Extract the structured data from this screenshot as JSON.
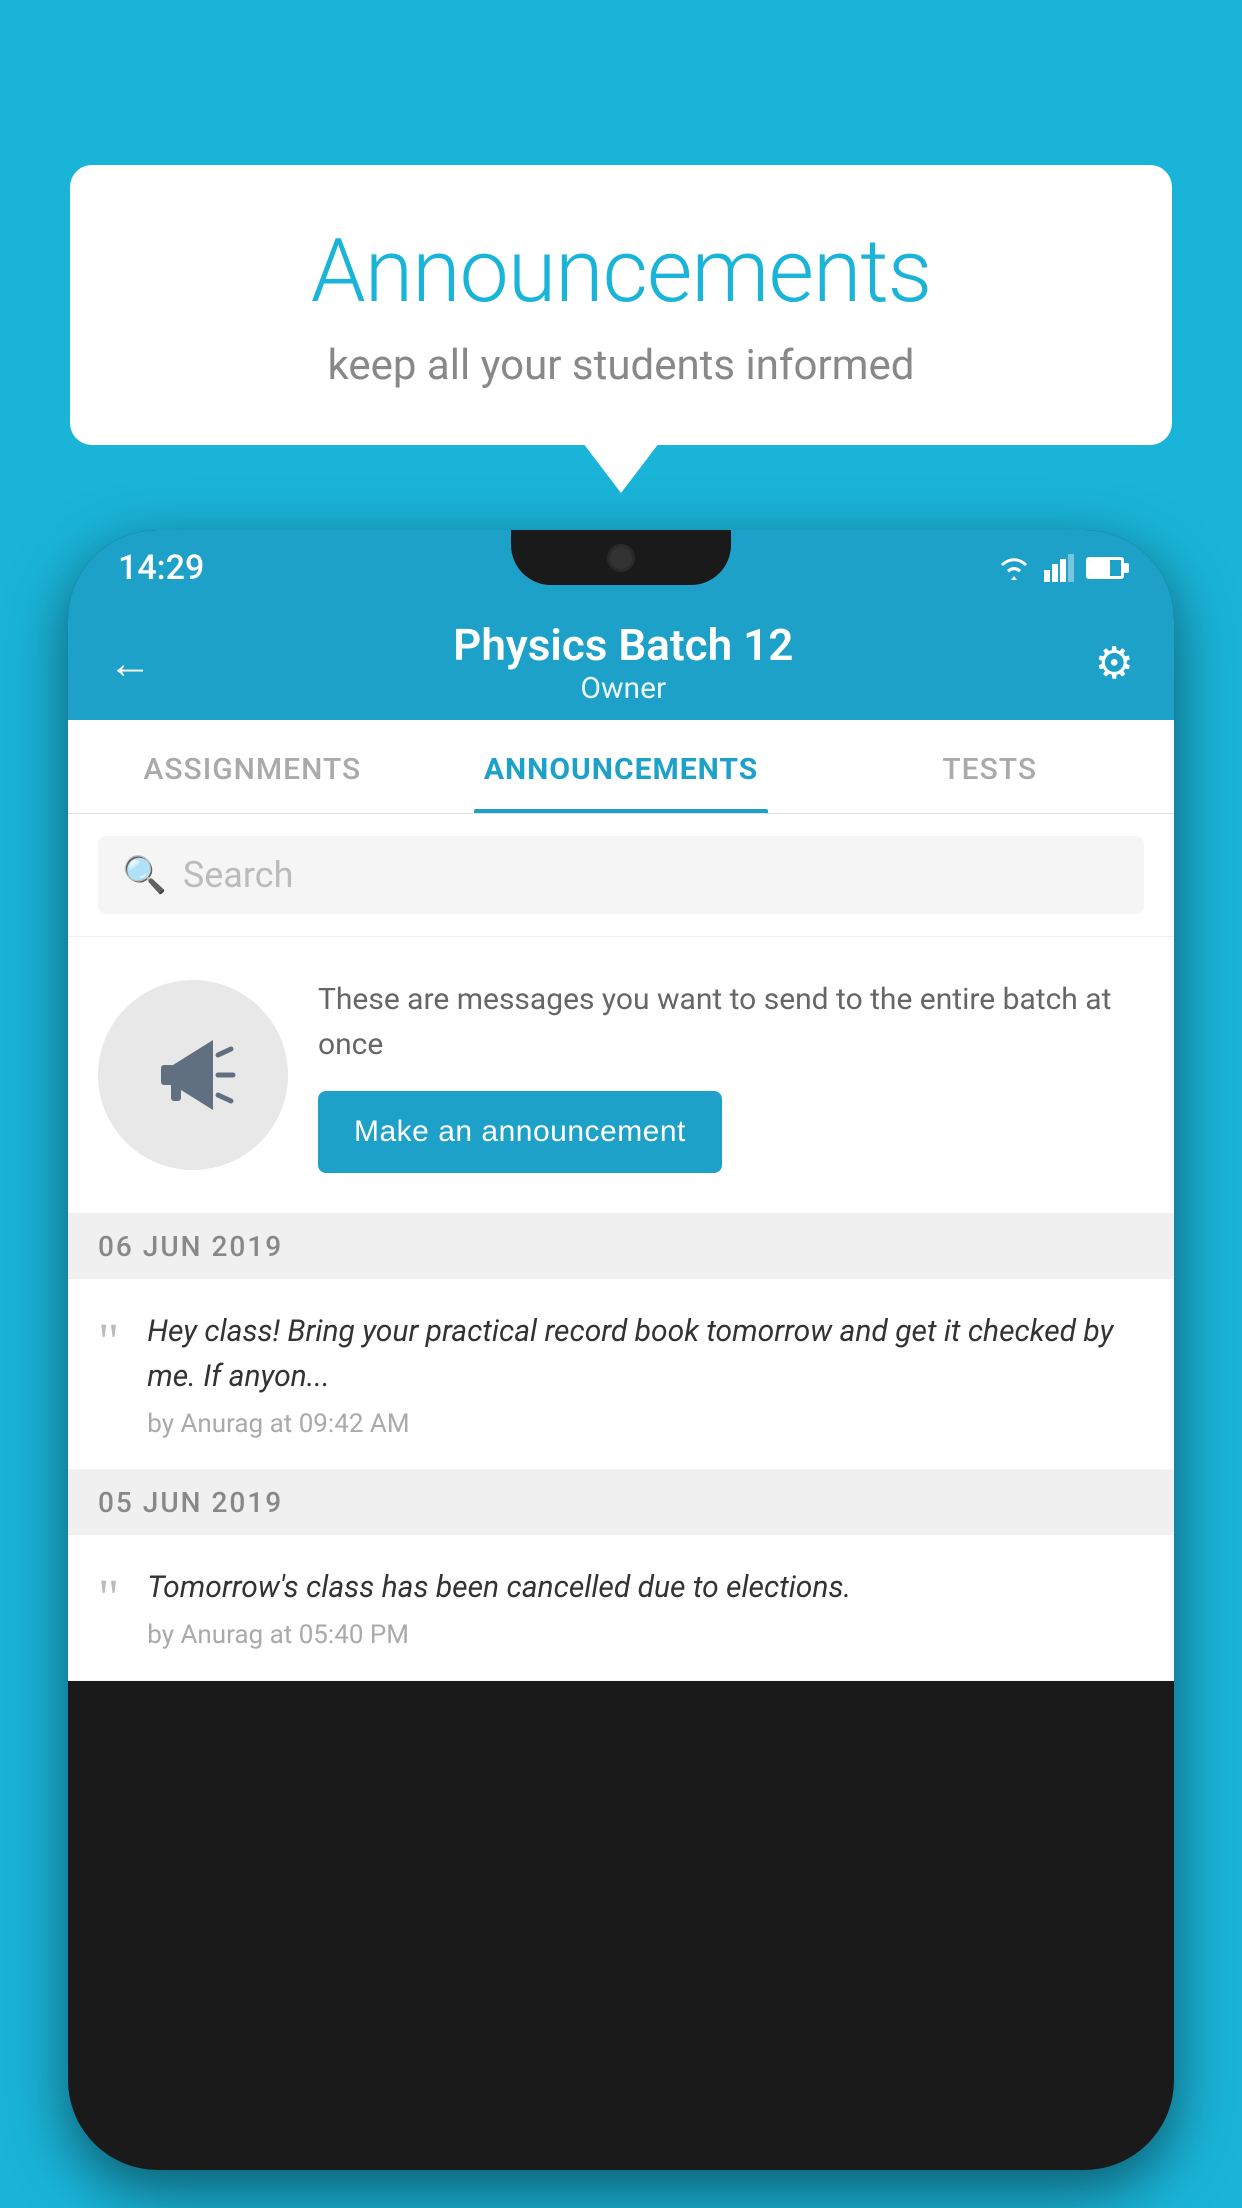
{
  "background_color": "#1ab4d8",
  "speech_bubble": {
    "title": "Announcements",
    "subtitle": "keep all your students informed"
  },
  "phone": {
    "status_bar": {
      "time": "14:29"
    },
    "header": {
      "title": "Physics Batch 12",
      "subtitle": "Owner",
      "back_label": "←",
      "gear_label": "⚙"
    },
    "tabs": [
      {
        "label": "ASSIGNMENTS",
        "active": false
      },
      {
        "label": "ANNOUNCEMENTS",
        "active": true
      },
      {
        "label": "TESTS",
        "active": false
      }
    ],
    "search": {
      "placeholder": "Search"
    },
    "promo": {
      "text": "These are messages you want to send to the entire batch at once",
      "button_label": "Make an announcement"
    },
    "announcements": [
      {
        "date": "06  JUN  2019",
        "text": "Hey class! Bring your practical record book tomorrow and get it checked by me. If anyon...",
        "meta": "by Anurag at 09:42 AM"
      },
      {
        "date": "05  JUN  2019",
        "text": "Tomorrow's class has been cancelled due to elections.",
        "meta": "by Anurag at 05:40 PM"
      }
    ]
  }
}
